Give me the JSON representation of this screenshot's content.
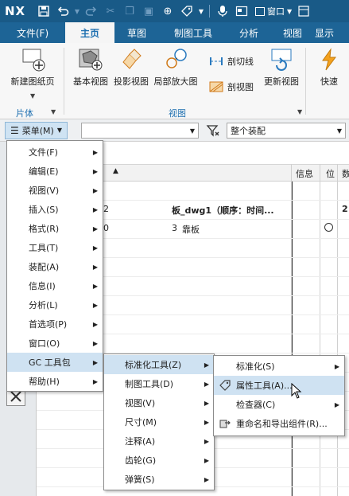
{
  "titlebar": {
    "logo": "NX",
    "window_menu": "窗口"
  },
  "tabs": [
    "文件(F)",
    "主页",
    "草图",
    "制图工具",
    "分析",
    "视图",
    "显示"
  ],
  "ribbon": {
    "new_sheet": "新建图纸页",
    "base_view": "基本视图",
    "projected_view": "投影视图",
    "detail_view": "局部放大图",
    "section_line": "剖切线",
    "section_view": "剖视图",
    "update_view": "更新视图",
    "quick": "快速",
    "group_sheet": "片体",
    "group_view": "视图"
  },
  "toolbar": {
    "menu_label": "菜单(M)",
    "filter_value": "",
    "assembly_value": "整个装配"
  },
  "table": {
    "headers": [
      "信息",
      "位",
      "数"
    ],
    "row1_part": "板_dwg1（顺序：时间...",
    "row1_num": "2",
    "row1_right": "2",
    "row2_part": "靠板",
    "row2_num": "3",
    "row2_left": "0"
  },
  "main_menu": {
    "items": [
      {
        "label": "文件(F)"
      },
      {
        "label": "编辑(E)"
      },
      {
        "label": "视图(V)"
      },
      {
        "label": "插入(S)"
      },
      {
        "label": "格式(R)"
      },
      {
        "label": "工具(T)"
      },
      {
        "label": "装配(A)"
      },
      {
        "label": "信息(I)"
      },
      {
        "label": "分析(L)"
      },
      {
        "label": "首选项(P)"
      },
      {
        "label": "窗口(O)"
      },
      {
        "label": "GC 工具包"
      },
      {
        "label": "帮助(H)"
      }
    ]
  },
  "gc_menu": {
    "items": [
      {
        "label": "标准化工具(Z)"
      },
      {
        "label": "制图工具(D)"
      },
      {
        "label": "视图(V)"
      },
      {
        "label": "尺寸(M)"
      },
      {
        "label": "注释(A)"
      },
      {
        "label": "齿轮(G)"
      },
      {
        "label": "弹簧(S)"
      }
    ]
  },
  "std_menu": {
    "items": [
      {
        "label": "标准化(S)"
      },
      {
        "label": "属性工具(A)..."
      },
      {
        "label": "检查器(C)"
      },
      {
        "label": "重命名和导出组件(R)..."
      }
    ]
  },
  "colors": {
    "titlebar": "#195a87",
    "tabbar": "#1d6496",
    "highlight": "#cfe2f2",
    "accent": "#1d6fb0"
  }
}
